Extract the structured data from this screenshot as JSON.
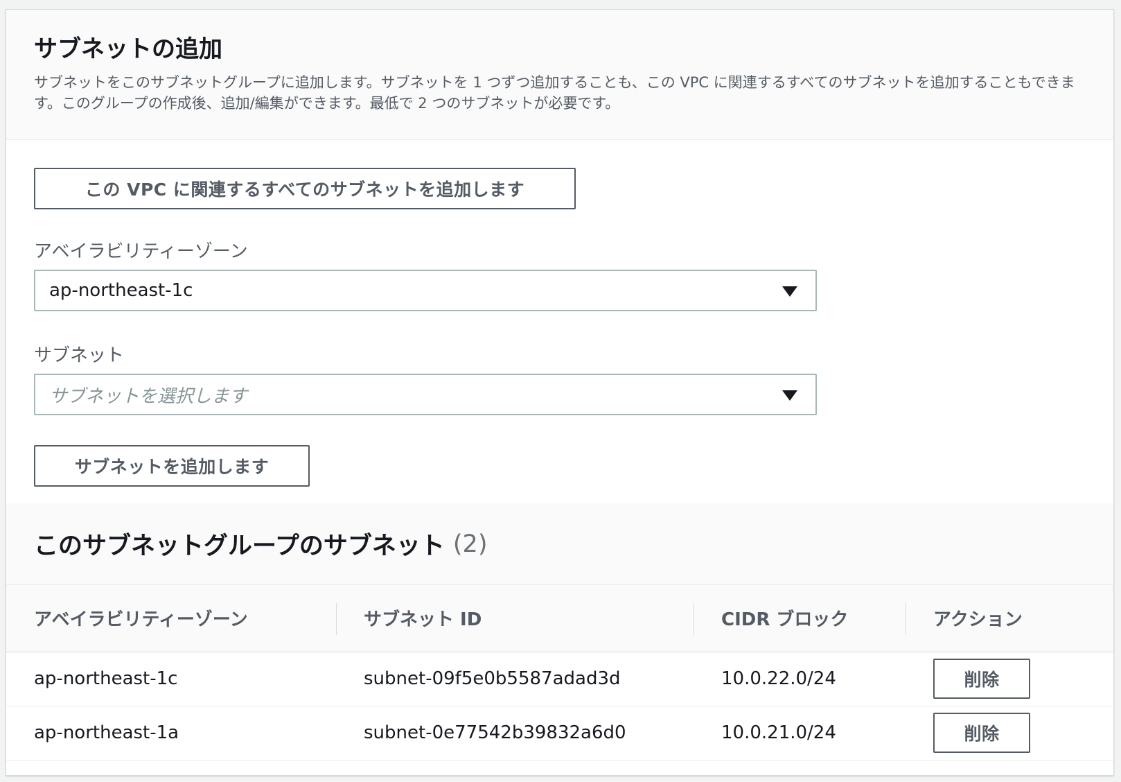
{
  "add_subnets": {
    "title": "サブネットの追加",
    "description": "サブネットをこのサブネットグループに追加します。サブネットを 1 つずつ追加することも、この VPC に関連するすべてのサブネットを追加することもできます。このグループの作成後、追加/編集ができます。最低で 2 つのサブネットが必要です。",
    "add_all_button": "この VPC に関連するすべてのサブネットを追加します",
    "az_label": "アベイラビリティーゾーン",
    "az_value": "ap-northeast-1c",
    "subnet_label": "サブネット",
    "subnet_placeholder": "サブネットを選択します",
    "add_subnet_button": "サブネットを追加します"
  },
  "subnets_table": {
    "title": "このサブネットグループのサブネット",
    "count": "(2)",
    "columns": [
      "アベイラビリティーゾーン",
      "サブネット ID",
      "CIDR ブロック",
      "アクション"
    ],
    "rows": [
      {
        "az": "ap-northeast-1c",
        "subnet_id": "subnet-09f5e0b5587adad3d",
        "cidr": "10.0.22.0/24",
        "action": "削除"
      },
      {
        "az": "ap-northeast-1a",
        "subnet_id": "subnet-0e77542b39832a6d0",
        "cidr": "10.0.21.0/24",
        "action": "削除"
      }
    ]
  },
  "colors": {
    "text_primary": "#16191f",
    "text_secondary": "#545b64",
    "placeholder": "#879596",
    "border": "#aab7b8",
    "header_bg": "#fafafa"
  },
  "icons": [
    "caret-down-icon"
  ]
}
